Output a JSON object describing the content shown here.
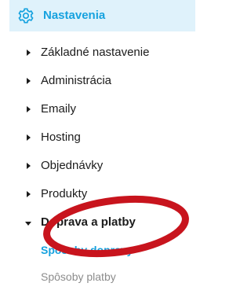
{
  "header": {
    "title": "Nastavenia",
    "icon": "gear-icon",
    "accent_color": "#16a2df",
    "background_color": "#dff2fb"
  },
  "menu": {
    "items": [
      {
        "label": "Základné nastavenie",
        "expanded": false
      },
      {
        "label": "Administrácia",
        "expanded": false
      },
      {
        "label": "Emaily",
        "expanded": false
      },
      {
        "label": "Hosting",
        "expanded": false
      },
      {
        "label": "Objednávky",
        "expanded": false
      },
      {
        "label": "Produkty",
        "expanded": false
      },
      {
        "label": "Doprava a platby",
        "expanded": true
      }
    ],
    "subitems": [
      {
        "label": "Spôsoby dopravy",
        "active": true
      },
      {
        "label": "Spôsoby platby",
        "active": false
      }
    ]
  },
  "annotation": {
    "shape": "ellipse-highlight",
    "color": "#c8141d"
  }
}
